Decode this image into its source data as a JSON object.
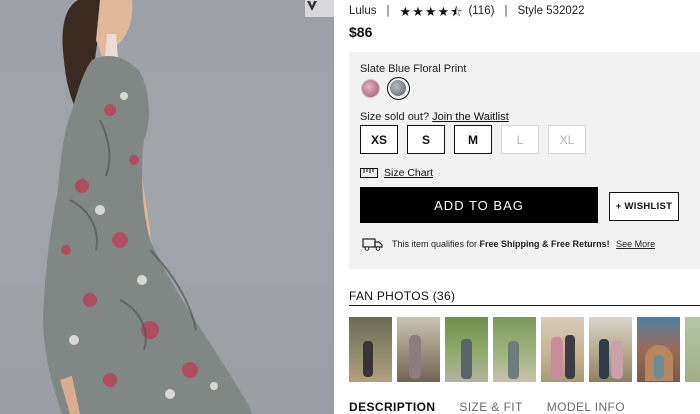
{
  "product": {
    "brand": "Lulus",
    "rating_value": 4.5,
    "rating_max": 5,
    "review_count": "(116)",
    "style": "Style 532022",
    "price": "$86"
  },
  "color": {
    "selected_name": "Slate Blue Floral Print",
    "swatch_colors": [
      "#c98aa0",
      "#858a95"
    ]
  },
  "sizes": {
    "prompt": "Size sold out?",
    "waitlist_link": "Join the Waitlist",
    "options": [
      {
        "label": "XS",
        "available": true
      },
      {
        "label": "S",
        "available": true
      },
      {
        "label": "M",
        "available": true
      },
      {
        "label": "L",
        "available": false
      },
      {
        "label": "XL",
        "available": false
      }
    ],
    "size_chart": "Size Chart"
  },
  "actions": {
    "add_to_bag": "ADD TO BAG",
    "wishlist": "+ WISHLIST"
  },
  "shipping": {
    "prefix": "This item qualifies for",
    "highlight": "Free Shipping & Free Returns!",
    "see_more": "See More"
  },
  "fan_photos": {
    "title": "FAN PHOTOS (36)",
    "count_visible": 8
  },
  "tabs": [
    "DESCRIPTION",
    "SIZE & FIT",
    "MODEL INFO"
  ],
  "colors": {
    "button_black": "#000000",
    "panel_bg": "#f2f2f2",
    "dress_slate": "#7d8682"
  }
}
